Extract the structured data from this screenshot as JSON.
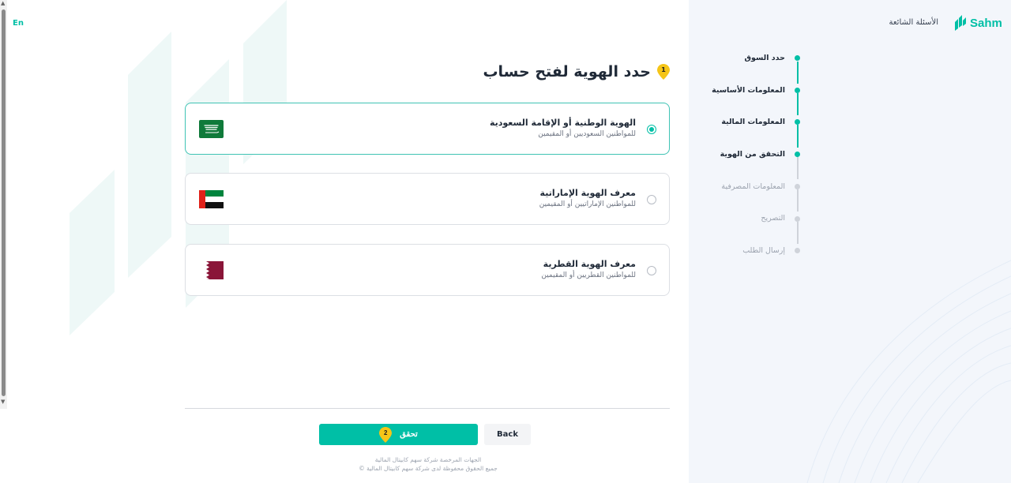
{
  "lang_toggle": "En",
  "header": {
    "logo_text": "Sahm",
    "faq_link": "الأسئلة الشائعة"
  },
  "steps": [
    {
      "label": "حدد السوق",
      "status": "done"
    },
    {
      "label": "المعلومات الأساسية",
      "status": "done"
    },
    {
      "label": "المعلومات المالية",
      "status": "done"
    },
    {
      "label": "التحقق من الهوية",
      "status": "current"
    },
    {
      "label": "المعلومات المصرفية",
      "status": "pending"
    },
    {
      "label": "التصريح",
      "status": "pending"
    },
    {
      "label": "إرسال الطلب",
      "status": "pending"
    }
  ],
  "main": {
    "title": "حدد الهوية لفتح حساب",
    "title_badge": "1",
    "options": [
      {
        "title": "الهوية الوطنية أو الإقامة السعودية",
        "subtitle": "للمواطنين السعوديين أو المقيمين",
        "flag": "saudi-flag",
        "selected": true
      },
      {
        "title": "معرف الهوية الإماراتية",
        "subtitle": "للمواطنين الإماراتيين أو المقيمين",
        "flag": "uae-flag",
        "selected": false
      },
      {
        "title": "معرف الهوية القطرية",
        "subtitle": "للمواطنين القطريين أو المقيمين",
        "flag": "qatar-flag",
        "selected": false
      }
    ],
    "verify_button": "تحقق",
    "verify_badge": "2",
    "back_button": "Back"
  },
  "footer": {
    "line1": "الجهات المرخصة شركة سهم كابيتال المالية",
    "line2": "جميع الحقوق محفوظة لدى شركة سهم كابيتال المالية ©"
  },
  "colors": {
    "accent": "#00bfa6",
    "badge": "#f5c518",
    "panel_bg": "#f3f6fb"
  }
}
